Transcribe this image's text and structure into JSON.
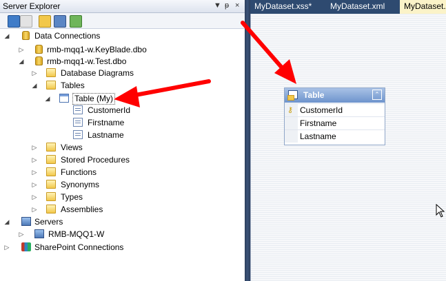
{
  "server_explorer": {
    "title": "Server Explorer",
    "title_buttons": [
      "▼",
      "ᵽ",
      "×"
    ],
    "toolbar": [
      "refresh-icon",
      "stop-icon",
      "connect-to-database-icon",
      "connect-to-server-icon",
      "connect-to-sharepoint-icon"
    ]
  },
  "tree": {
    "data_connections": "Data Connections",
    "conn1": "rmb-mqq1-w.KeyBlade.dbo",
    "conn2": "rmb-mqq1-w.Test.dbo",
    "database_diagrams": "Database Diagrams",
    "tables": "Tables",
    "table_my": "Table (My)",
    "col1": "CustomerId",
    "col2": "Firstname",
    "col3": "Lastname",
    "views": "Views",
    "stored_procedures": "Stored Procedures",
    "functions": "Functions",
    "synonyms": "Synonyms",
    "types": "Types",
    "assemblies": "Assemblies",
    "servers": "Servers",
    "server1": "RMB-MQQ1-W",
    "sharepoint": "SharePoint Connections"
  },
  "doc_tabs": [
    "MyDataset.xss*",
    "MyDataset.xml",
    "MyDataset.x"
  ],
  "designer": {
    "table_title": "Table",
    "collapse_symbol": "⌃",
    "rows": [
      "CustomerId",
      "Firstname",
      "Lastname"
    ]
  },
  "colors": {
    "splitter": "#3b5378",
    "tab_bar": "#2e4a70",
    "active_tab": "#fbf3c8",
    "arrow": "#ff0000"
  }
}
